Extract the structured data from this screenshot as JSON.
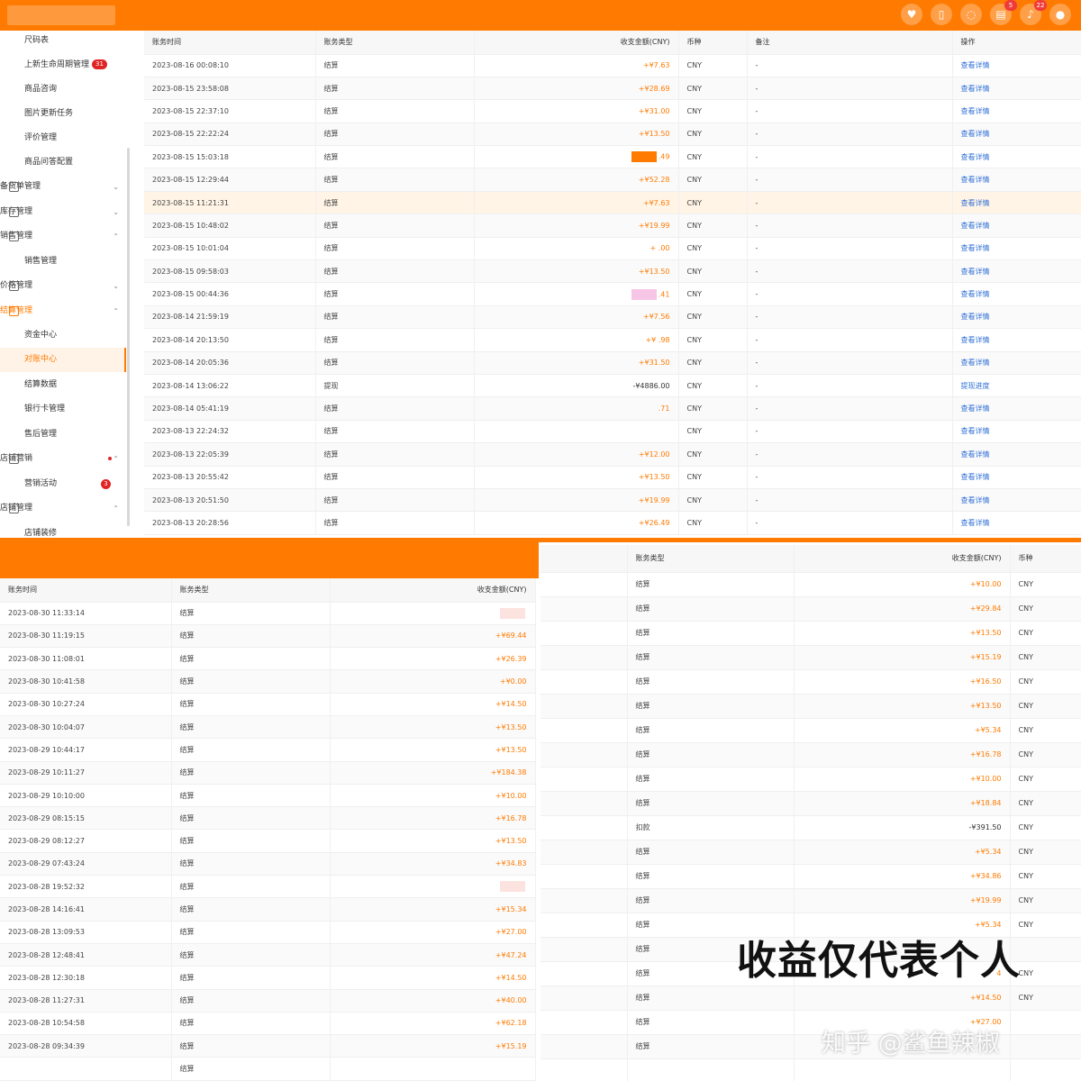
{
  "header": {
    "icon_badges": [
      "5",
      "22"
    ]
  },
  "sidebar": {
    "items": [
      {
        "label": "尺码表",
        "kind": "sub"
      },
      {
        "label": "上新生命周期管理",
        "kind": "sub",
        "badge": "31"
      },
      {
        "label": "商品咨询",
        "kind": "sub"
      },
      {
        "label": "图片更新任务",
        "kind": "sub"
      },
      {
        "label": "评价管理",
        "kind": "sub"
      },
      {
        "label": "商品问答配置",
        "kind": "sub"
      },
      {
        "label": "备货单管理",
        "kind": "group",
        "chevron": "⌄"
      },
      {
        "label": "库存管理",
        "kind": "group",
        "chevron": "⌄"
      },
      {
        "label": "销售管理",
        "kind": "group",
        "chevron": "⌃"
      },
      {
        "label": "销售管理",
        "kind": "sub"
      },
      {
        "label": "价格管理",
        "kind": "group",
        "chevron": "⌄"
      },
      {
        "label": "结算管理",
        "kind": "group",
        "chevron": "⌃",
        "orange": true
      },
      {
        "label": "资金中心",
        "kind": "sub"
      },
      {
        "label": "对账中心",
        "kind": "sub",
        "active": true
      },
      {
        "label": "结算数据",
        "kind": "sub"
      },
      {
        "label": "银行卡管理",
        "kind": "sub"
      },
      {
        "label": "售后管理",
        "kind": "sub"
      },
      {
        "label": "店铺营销",
        "kind": "group",
        "chevron": "⌃",
        "dot": true
      },
      {
        "label": "营销活动",
        "kind": "sub",
        "count": "3"
      },
      {
        "label": "店铺管理",
        "kind": "group",
        "chevron": "⌃"
      },
      {
        "label": "店铺装修",
        "kind": "sub"
      }
    ]
  },
  "top_table": {
    "columns": [
      "账务时间",
      "账务类型",
      "收支金额(CNY)",
      "币种",
      "备注",
      "操作"
    ],
    "rows": [
      {
        "time": "2023-08-16 00:08:10",
        "type": "结算",
        "amount": "+¥7.63",
        "cur": "CNY",
        "note": "-",
        "op": "查看详情"
      },
      {
        "time": "2023-08-15 23:58:08",
        "type": "结算",
        "amount": "+¥28.69",
        "cur": "CNY",
        "note": "-",
        "op": "查看详情"
      },
      {
        "time": "2023-08-15 22:37:10",
        "type": "结算",
        "amount": "+¥31.00",
        "cur": "CNY",
        "note": "-",
        "op": "查看详情"
      },
      {
        "time": "2023-08-15 22:22:24",
        "type": "结算",
        "amount": "+¥13.50",
        "cur": "CNY",
        "note": "-",
        "op": "查看详情"
      },
      {
        "time": "2023-08-15 15:03:18",
        "type": "结算",
        "amount": ".49",
        "cur": "CNY",
        "note": "-",
        "op": "查看详情",
        "blot": "#ff7a00"
      },
      {
        "time": "2023-08-15 12:29:44",
        "type": "结算",
        "amount": "+¥52.28",
        "cur": "CNY",
        "note": "-",
        "op": "查看详情"
      },
      {
        "time": "2023-08-15 11:21:31",
        "type": "结算",
        "amount": "+¥7.63",
        "cur": "CNY",
        "note": "-",
        "op": "查看详情",
        "hl": true
      },
      {
        "time": "2023-08-15 10:48:02",
        "type": "结算",
        "amount": "+¥19.99",
        "cur": "CNY",
        "note": "-",
        "op": "查看详情"
      },
      {
        "time": "2023-08-15 10:01:04",
        "type": "结算",
        "amount": "+ .00",
        "cur": "CNY",
        "note": "-",
        "op": "查看详情"
      },
      {
        "time": "2023-08-15 09:58:03",
        "type": "结算",
        "amount": "+¥13.50",
        "cur": "CNY",
        "note": "-",
        "op": "查看详情"
      },
      {
        "time": "2023-08-15 00:44:36",
        "type": "结算",
        "amount": ".41",
        "cur": "CNY",
        "note": "-",
        "op": "查看详情",
        "blot": "#f7c6e6"
      },
      {
        "time": "2023-08-14 21:59:19",
        "type": "结算",
        "amount": "+¥7.56",
        "cur": "CNY",
        "note": "-",
        "op": "查看详情"
      },
      {
        "time": "2023-08-14 20:13:50",
        "type": "结算",
        "amount": "+¥ .98",
        "cur": "CNY",
        "note": "-",
        "op": "查看详情"
      },
      {
        "time": "2023-08-14 20:05:36",
        "type": "结算",
        "amount": "+¥31.50",
        "cur": "CNY",
        "note": "-",
        "op": "查看详情"
      },
      {
        "time": "2023-08-14 13:06:22",
        "type": "提现",
        "amount": "-¥4886.00",
        "cur": "CNY",
        "note": "-",
        "op": "提现进度",
        "neg": true
      },
      {
        "time": "2023-08-14 05:41:19",
        "type": "结算",
        "amount": ".71",
        "cur": "CNY",
        "note": "-",
        "op": "查看详情"
      },
      {
        "time": "2023-08-13 22:24:32",
        "type": "结算",
        "amount": "",
        "cur": "CNY",
        "note": "-",
        "op": "查看详情"
      },
      {
        "time": "2023-08-13 22:05:39",
        "type": "结算",
        "amount": "+¥12.00",
        "cur": "CNY",
        "note": "-",
        "op": "查看详情"
      },
      {
        "time": "2023-08-13 20:55:42",
        "type": "结算",
        "amount": "+¥13.50",
        "cur": "CNY",
        "note": "-",
        "op": "查看详情"
      },
      {
        "time": "2023-08-13 20:51:50",
        "type": "结算",
        "amount": "+¥19.99",
        "cur": "CNY",
        "note": "-",
        "op": "查看详情"
      },
      {
        "time": "2023-08-13 20:28:56",
        "type": "结算",
        "amount": "+¥26.49",
        "cur": "CNY",
        "note": "-",
        "op": "查看详情"
      }
    ]
  },
  "bottom_left_table": {
    "columns": [
      "账务时间",
      "账务类型",
      "收支金额(CNY)"
    ],
    "rows": [
      {
        "time": "2023-08-30 11:33:14",
        "type": "结算",
        "amount": "",
        "blot": "#fde3df"
      },
      {
        "time": "2023-08-30 11:19:15",
        "type": "结算",
        "amount": "+¥69.44"
      },
      {
        "time": "2023-08-30 11:08:01",
        "type": "结算",
        "amount": "+¥26.39"
      },
      {
        "time": "2023-08-30 10:41:58",
        "type": "结算",
        "amount": "+¥0.00"
      },
      {
        "time": "2023-08-30 10:27:24",
        "type": "结算",
        "amount": "+¥14.50"
      },
      {
        "time": "2023-08-30 10:04:07",
        "type": "结算",
        "amount": "+¥13.50"
      },
      {
        "time": "2023-08-29 10:44:17",
        "type": "结算",
        "amount": "+¥13.50"
      },
      {
        "time": "2023-08-29 10:11:27",
        "type": "结算",
        "amount": "+¥184.38"
      },
      {
        "time": "2023-08-29 10:10:00",
        "type": "结算",
        "amount": "+¥10.00"
      },
      {
        "time": "2023-08-29 08:15:15",
        "type": "结算",
        "amount": "+¥16.78"
      },
      {
        "time": "2023-08-29 08:12:27",
        "type": "结算",
        "amount": "+¥13.50"
      },
      {
        "time": "2023-08-29 07:43:24",
        "type": "结算",
        "amount": "+¥34.83"
      },
      {
        "time": "2023-08-28 19:52:32",
        "type": "结算",
        "amount": "",
        "blot": "#fde3df"
      },
      {
        "time": "2023-08-28 14:16:41",
        "type": "结算",
        "amount": "+¥15.34"
      },
      {
        "time": "2023-08-28 13:09:53",
        "type": "结算",
        "amount": "+¥27.00"
      },
      {
        "time": "2023-08-28 12:48:41",
        "type": "结算",
        "amount": "+¥47.24"
      },
      {
        "time": "2023-08-28 12:30:18",
        "type": "结算",
        "amount": "+¥14.50"
      },
      {
        "time": "2023-08-28 11:27:31",
        "type": "结算",
        "amount": "+¥40.00"
      },
      {
        "time": "2023-08-28 10:54:58",
        "type": "结算",
        "amount": "+¥62.18"
      },
      {
        "time": "2023-08-28 09:34:39",
        "type": "结算",
        "amount": "+¥15.19"
      },
      {
        "time": "",
        "type": "结算",
        "amount": ""
      }
    ]
  },
  "bottom_right_table": {
    "columns": [
      "账务类型",
      "收支金额(CNY)",
      "币种"
    ],
    "rows": [
      {
        "type": "结算",
        "amount": "+¥10.00",
        "cur": "CNY"
      },
      {
        "type": "结算",
        "amount": "+¥29.84",
        "cur": "CNY"
      },
      {
        "type": "结算",
        "amount": "+¥13.50",
        "cur": "CNY"
      },
      {
        "type": "结算",
        "amount": "+¥15.19",
        "cur": "CNY"
      },
      {
        "type": "结算",
        "amount": "+¥16.50",
        "cur": "CNY"
      },
      {
        "type": "结算",
        "amount": "+¥13.50",
        "cur": "CNY"
      },
      {
        "type": "结算",
        "amount": "+¥5.34",
        "cur": "CNY"
      },
      {
        "type": "结算",
        "amount": "+¥16.78",
        "cur": "CNY"
      },
      {
        "type": "结算",
        "amount": "+¥10.00",
        "cur": "CNY"
      },
      {
        "type": "结算",
        "amount": "+¥18.84",
        "cur": "CNY"
      },
      {
        "type": "扣款",
        "amount": "-¥391.50",
        "cur": "CNY",
        "neg": true
      },
      {
        "type": "结算",
        "amount": "+¥5.34",
        "cur": "CNY"
      },
      {
        "type": "结算",
        "amount": "+¥34.86",
        "cur": "CNY"
      },
      {
        "type": "结算",
        "amount": "+¥19.99",
        "cur": "CNY"
      },
      {
        "type": "结算",
        "amount": "+¥5.34",
        "cur": "CNY"
      },
      {
        "type": "结算",
        "amount": "",
        "cur": ""
      },
      {
        "type": "结算",
        "amount": "4",
        "cur": "CNY"
      },
      {
        "type": "结算",
        "amount": "+¥14.50",
        "cur": "CNY"
      },
      {
        "type": "结算",
        "amount": "+¥27.00",
        "cur": ""
      },
      {
        "type": "结算",
        "amount": "",
        "cur": ""
      },
      {
        "type": "",
        "amount": "",
        "cur": ""
      }
    ]
  },
  "caption": "收益仅代表个人",
  "watermark": "知乎 @鲨鱼辣椒",
  "colors": {
    "accent": "#ff7a00",
    "link": "#2f6fd6",
    "badge": "#e02424"
  },
  "icons": [
    "heart-icon",
    "book-icon",
    "chat-icon",
    "document-icon",
    "bell-icon",
    "user-icon"
  ]
}
